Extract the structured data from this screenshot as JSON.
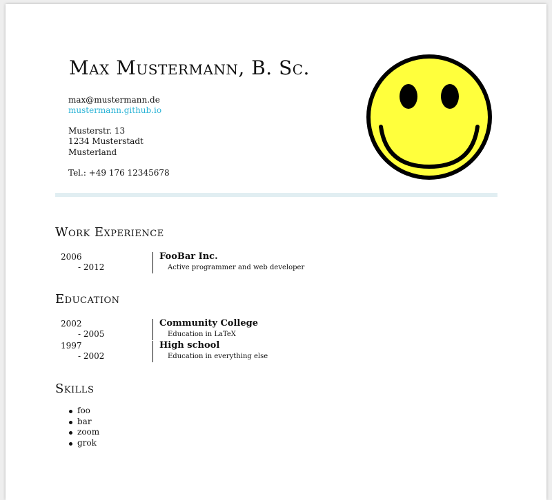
{
  "header": {
    "name": "Max Mustermann, B. Sc.",
    "email": "max@mustermann.de",
    "website": "mustermann.github.io",
    "address": [
      "Musterstr. 13",
      "1234  Musterstadt",
      "Musterland"
    ],
    "phone": "Tel.: +49 176 12345678",
    "avatar_icon": "smiley-face-icon"
  },
  "colors": {
    "link": "#2ab3d6",
    "rule": "#e1eef2",
    "smiley_fill": "#ffff3c"
  },
  "work": {
    "title": "Work Experience",
    "entries": [
      {
        "start": "2006",
        "end": "- 2012",
        "org": "FooBar Inc.",
        "desc": "Active programmer and web developer"
      }
    ]
  },
  "education": {
    "title": "Education",
    "entries": [
      {
        "start": "2002",
        "end": "- 2005",
        "org": "Community College",
        "desc": "Education in LaTeX"
      },
      {
        "start": "1997",
        "end": "- 2002",
        "org": "High school",
        "desc": "Education in everything else"
      }
    ]
  },
  "skills": {
    "title": "Skills",
    "items": [
      "foo",
      "bar",
      "zoom",
      "grok"
    ]
  }
}
